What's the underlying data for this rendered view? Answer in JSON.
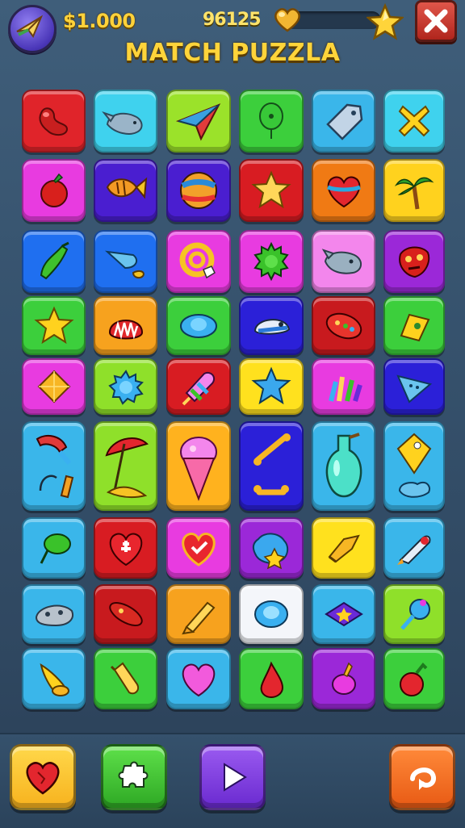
{
  "hud": {
    "coins": "$1.000",
    "score": "96125",
    "progress_fraction": 0.0,
    "title": "MATCH PUZZLA"
  },
  "colors": {
    "title": "#ffd43a",
    "coins": "#ffd23a",
    "background": "#3f5e7a"
  },
  "board": {
    "rows": [
      [
        "red-bean",
        "cyan-whale",
        "lime-paper-plane",
        "green-balloon",
        "sky-tag",
        "sky-x-cross"
      ],
      [
        "magenta-tomato",
        "indigo-fish",
        "indigo-beach-ball",
        "red-star",
        "orange-heart-gem",
        "yellow-palm-tree"
      ],
      [
        "blue-pepper",
        "blue-shark-fin",
        "magenta-swirl-hand",
        "magenta-green-gear",
        "pink-whale",
        "purple-red-mask"
      ],
      [
        "green-star",
        "orange-shell",
        "green-blue-disc",
        "blue-helmet",
        "red-badge",
        "green-pennant"
      ],
      [
        "magenta-diamond",
        "lime-blue-flower",
        "red-ice-pop",
        "yellow-blue-star",
        "magenta-paintbrushes",
        "indigo-triangle-flag"
      ],
      [
        "sky-hammer-tools",
        "lime-beach-umbrella",
        "yellow-ice-cream",
        "indigo-bones",
        "sky-potion-bottle",
        "sky-kite"
      ],
      [
        "sky-green-balloon",
        "red-heart-cross",
        "magenta-heart-check",
        "purple-paint-splat",
        "yellow-hat",
        "sky-rocket"
      ],
      [
        "sky-stone",
        "red-torpedo",
        "orange-crayon",
        "white-blue-gem",
        "sky-purple-star-gem",
        "lime-bulb"
      ],
      [
        "sky-horn",
        "green-bottle",
        "sky-pink-heart",
        "green-red-drop",
        "purple-bird",
        "green-red-pepper"
      ]
    ]
  },
  "buttons": [
    {
      "icon": "heart-icon"
    },
    {
      "icon": "puzzle-icon"
    },
    {
      "icon": "play-icon"
    },
    {
      "icon": "rotate-icon"
    }
  ]
}
